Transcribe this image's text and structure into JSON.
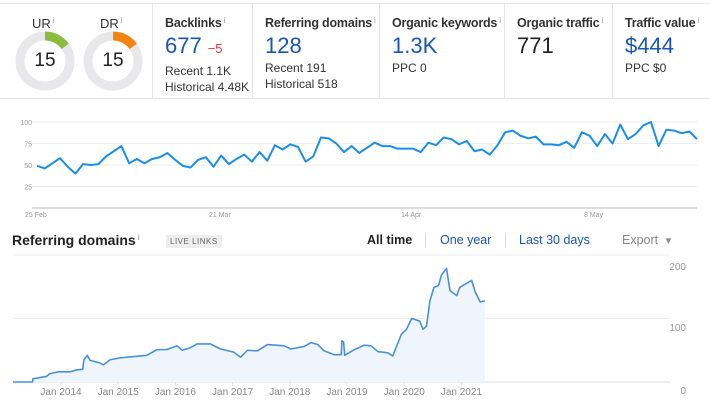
{
  "metrics": {
    "ur": {
      "label": "UR",
      "value": "15",
      "fraction": 0.15,
      "color": "#8bbd3c"
    },
    "dr": {
      "label": "DR",
      "value": "15",
      "fraction": 0.15,
      "color": "#f5830f"
    },
    "backlinks": {
      "label": "Backlinks",
      "value": "677",
      "delta": "−5",
      "recent": "Recent 1.1K",
      "historical": "Historical 4.48K"
    },
    "referring_domains": {
      "label": "Referring domains",
      "value": "128",
      "recent": "Recent 191",
      "historical": "Historical 518"
    },
    "organic_keywords": {
      "label": "Organic keywords",
      "value": "1.3K",
      "ppc": "PPC 0"
    },
    "organic_traffic": {
      "label": "Organic traffic",
      "value": "771"
    },
    "traffic_value": {
      "label": "Traffic value",
      "value": "$444",
      "ppc": "PPC $0"
    },
    "info_icon": "i"
  },
  "chart_data": [
    {
      "type": "line",
      "color": "#1a8ee8",
      "grid": true,
      "ylim": [
        0,
        100
      ],
      "yticks": [
        "100",
        "75",
        "50",
        "25"
      ],
      "xticks": [
        "25 Feb",
        "21 Mar",
        "14 Apr",
        "8 May"
      ],
      "values": [
        49,
        46,
        52,
        58,
        48,
        40,
        51,
        50,
        51,
        60,
        66,
        72,
        52,
        57,
        52,
        57,
        59,
        64,
        56,
        49,
        47,
        56,
        59,
        48,
        61,
        51,
        57,
        62,
        54,
        65,
        55,
        73,
        68,
        74,
        71,
        54,
        60,
        82,
        81,
        75,
        65,
        72,
        64,
        70,
        76,
        72,
        72,
        69,
        69,
        69,
        65,
        76,
        73,
        82,
        80,
        74,
        78,
        66,
        68,
        62,
        73,
        88,
        90,
        84,
        81,
        83,
        74,
        74,
        73,
        77,
        70,
        88,
        84,
        72,
        86,
        75,
        97,
        80,
        86,
        96,
        100,
        72,
        91,
        90,
        87,
        89,
        80
      ]
    },
    {
      "type": "area",
      "title": "Referring domains",
      "badge": "LIVE LINKS",
      "color": "#4a90d9",
      "fill": "#eef5fc",
      "grid": true,
      "ylim": [
        0,
        200
      ],
      "yticks": [
        "200",
        "100",
        "0"
      ],
      "xticks": [
        "Jan 2014",
        "Jan 2015",
        "Jan 2016",
        "Jan 2017",
        "Jan 2018",
        "Jan 2019",
        "Jan 2020",
        "Jan 2021"
      ],
      "points": [
        [
          2013.16,
          0
        ],
        [
          2013.5,
          0
        ],
        [
          2013.51,
          5
        ],
        [
          2013.75,
          9
        ],
        [
          2013.8,
          13
        ],
        [
          2013.95,
          16
        ],
        [
          2014.16,
          16
        ],
        [
          2014.27,
          19
        ],
        [
          2014.38,
          20
        ],
        [
          2014.4,
          35
        ],
        [
          2014.46,
          42
        ],
        [
          2014.51,
          34
        ],
        [
          2014.68,
          30
        ],
        [
          2014.74,
          27
        ],
        [
          2014.86,
          35
        ],
        [
          2015.03,
          38
        ],
        [
          2015.27,
          40
        ],
        [
          2015.5,
          42
        ],
        [
          2015.68,
          51
        ],
        [
          2015.85,
          51
        ],
        [
          2016.03,
          57
        ],
        [
          2016.12,
          50
        ],
        [
          2016.26,
          54
        ],
        [
          2016.38,
          60
        ],
        [
          2016.61,
          60
        ],
        [
          2016.79,
          52
        ],
        [
          2017.02,
          47
        ],
        [
          2017.14,
          39
        ],
        [
          2017.26,
          50
        ],
        [
          2017.43,
          49
        ],
        [
          2017.61,
          59
        ],
        [
          2017.9,
          57
        ],
        [
          2018.02,
          52
        ],
        [
          2018.25,
          56
        ],
        [
          2018.37,
          62
        ],
        [
          2018.49,
          59
        ],
        [
          2018.6,
          49
        ],
        [
          2018.78,
          43
        ],
        [
          2018.9,
          43
        ],
        [
          2018.91,
          65
        ],
        [
          2018.94,
          63
        ],
        [
          2018.96,
          42
        ],
        [
          2019.13,
          51
        ],
        [
          2019.3,
          58
        ],
        [
          2019.42,
          57
        ],
        [
          2019.54,
          48
        ],
        [
          2019.71,
          46
        ],
        [
          2019.8,
          41
        ],
        [
          2019.95,
          75
        ],
        [
          2020.04,
          83
        ],
        [
          2020.13,
          100
        ],
        [
          2020.27,
          96
        ],
        [
          2020.33,
          83
        ],
        [
          2020.39,
          88
        ],
        [
          2020.45,
          128
        ],
        [
          2020.52,
          149
        ],
        [
          2020.6,
          152
        ],
        [
          2020.65,
          168
        ],
        [
          2020.74,
          179
        ],
        [
          2020.8,
          144
        ],
        [
          2020.92,
          136
        ],
        [
          2020.97,
          149
        ],
        [
          2021.12,
          157
        ],
        [
          2021.18,
          160
        ],
        [
          2021.24,
          142
        ],
        [
          2021.33,
          126
        ],
        [
          2021.41,
          128
        ]
      ]
    }
  ],
  "range_tabs": [
    {
      "label": "All time",
      "active": true
    },
    {
      "label": "One year",
      "active": false
    },
    {
      "label": "Last 30 days",
      "active": false
    }
  ],
  "export": {
    "label": "Export",
    "icon": "caret-down-icon",
    "caret": "▾"
  }
}
